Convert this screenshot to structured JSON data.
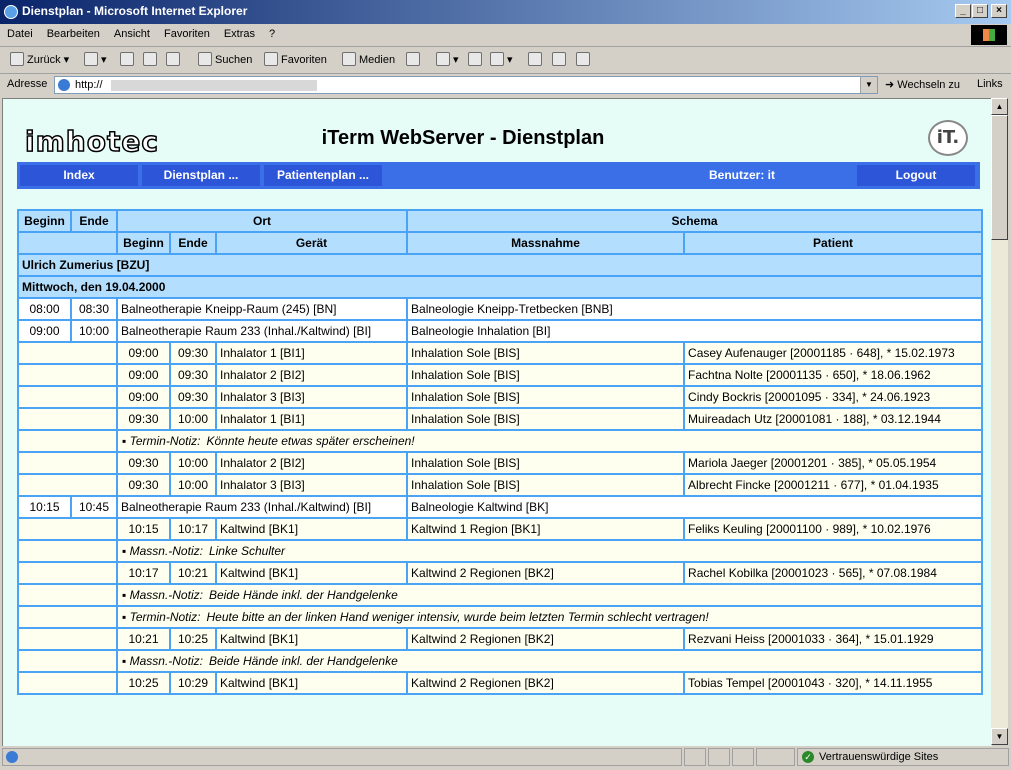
{
  "window": {
    "title": "Dienstplan - Microsoft Internet Explorer"
  },
  "menu": [
    "Datei",
    "Bearbeiten",
    "Ansicht",
    "Favoriten",
    "Extras",
    "?"
  ],
  "toolbar": {
    "back": "Zurück",
    "search": "Suchen",
    "favorites": "Favoriten",
    "media": "Medien"
  },
  "address": {
    "label": "Adresse",
    "value": "http://",
    "go": "Wechseln zu",
    "links": "Links"
  },
  "status": {
    "zone": "Vertrauenswürdige Sites"
  },
  "page": {
    "logo": "imhotec",
    "title": "iTerm WebServer - Dienstplan",
    "it_logo": "iT.",
    "nav": {
      "index": "Index",
      "dienstplan": "Dienstplan ...",
      "patientenplan": "Patientenplan ...",
      "user": "Benutzer: it",
      "logout": "Logout"
    }
  },
  "table": {
    "head1": {
      "beginn": "Beginn",
      "ende": "Ende",
      "ort": "Ort",
      "schema": "Schema"
    },
    "head2": {
      "beginn": "Beginn",
      "ende": "Ende",
      "geraet": "Gerät",
      "massnahme": "Massnahme",
      "patient": "Patient"
    },
    "person": "Ulrich Zumerius [BZU]",
    "date": "Mittwoch, den 19.04.2000",
    "rows": [
      {
        "type": "main",
        "beginn": "08:00",
        "ende": "08:30",
        "ort": "Balneotherapie Kneipp-Raum (245) [BN]",
        "schema": "Balneologie Kneipp-Tretbecken [BNB]"
      },
      {
        "type": "main",
        "beginn": "09:00",
        "ende": "10:00",
        "ort": "Balneotherapie Raum 233 (Inhal./Kaltwind) [BI]",
        "schema": "Balneologie Inhalation [BI]"
      },
      {
        "type": "sub",
        "beginn": "09:00",
        "ende": "09:30",
        "geraet": "Inhalator 1 [BI1]",
        "massnahme": "Inhalation Sole [BIS]",
        "patient": "Casey Aufenauger [20001185 · 648], * 15.02.1973"
      },
      {
        "type": "sub",
        "beginn": "09:00",
        "ende": "09:30",
        "geraet": "Inhalator 2 [BI2]",
        "massnahme": "Inhalation Sole [BIS]",
        "patient": "Fachtna Nolte [20001135 · 650], * 18.06.1962"
      },
      {
        "type": "sub",
        "beginn": "09:00",
        "ende": "09:30",
        "geraet": "Inhalator 3 [BI3]",
        "massnahme": "Inhalation Sole [BIS]",
        "patient": "Cindy Bockris [20001095 · 334], * 24.06.1923"
      },
      {
        "type": "sub",
        "beginn": "09:30",
        "ende": "10:00",
        "geraet": "Inhalator 1 [BI1]",
        "massnahme": "Inhalation Sole [BIS]",
        "patient": "Muireadach Utz [20001081 · 188], * 03.12.1944"
      },
      {
        "type": "note",
        "key": "Termin-Notiz:",
        "text": "Könnte heute etwas später erscheinen!"
      },
      {
        "type": "sub",
        "beginn": "09:30",
        "ende": "10:00",
        "geraet": "Inhalator 2 [BI2]",
        "massnahme": "Inhalation Sole [BIS]",
        "patient": "Mariola Jaeger [20001201 · 385], * 05.05.1954"
      },
      {
        "type": "sub",
        "beginn": "09:30",
        "ende": "10:00",
        "geraet": "Inhalator 3 [BI3]",
        "massnahme": "Inhalation Sole [BIS]",
        "patient": "Albrecht Fincke [20001211 · 677], * 01.04.1935"
      },
      {
        "type": "main",
        "beginn": "10:15",
        "ende": "10:45",
        "ort": "Balneotherapie Raum 233 (Inhal./Kaltwind) [BI]",
        "schema": "Balneologie Kaltwind [BK]"
      },
      {
        "type": "sub",
        "beginn": "10:15",
        "ende": "10:17",
        "geraet": "Kaltwind [BK1]",
        "massnahme": "Kaltwind 1 Region [BK1]",
        "patient": "Feliks Keuling [20001100 · 989], * 10.02.1976"
      },
      {
        "type": "note",
        "key": "Massn.-Notiz:",
        "text": "Linke Schulter"
      },
      {
        "type": "sub",
        "beginn": "10:17",
        "ende": "10:21",
        "geraet": "Kaltwind [BK1]",
        "massnahme": "Kaltwind 2 Regionen [BK2]",
        "patient": "Rachel Kobilka [20001023 · 565], * 07.08.1984"
      },
      {
        "type": "note",
        "key": "Massn.-Notiz:",
        "text": "Beide Hände inkl. der Handgelenke"
      },
      {
        "type": "note",
        "key": "Termin-Notiz:",
        "text": "Heute bitte an der linken Hand weniger intensiv, wurde beim letzten Termin schlecht vertragen!"
      },
      {
        "type": "sub",
        "beginn": "10:21",
        "ende": "10:25",
        "geraet": "Kaltwind [BK1]",
        "massnahme": "Kaltwind 2 Regionen [BK2]",
        "patient": "Rezvani Heiss [20001033 · 364], * 15.01.1929"
      },
      {
        "type": "note",
        "key": "Massn.-Notiz:",
        "text": "Beide Hände inkl. der Handgelenke"
      },
      {
        "type": "sub",
        "beginn": "10:25",
        "ende": "10:29",
        "geraet": "Kaltwind [BK1]",
        "massnahme": "Kaltwind 2 Regionen [BK2]",
        "patient": "Tobias Tempel [20001043 · 320], * 14.11.1955"
      }
    ]
  }
}
